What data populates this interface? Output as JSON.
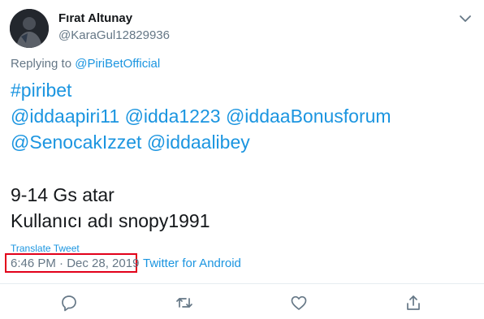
{
  "author": {
    "display_name": "Fırat Altunay",
    "handle": "@KaraGul12829936"
  },
  "reply": {
    "prefix": "Replying to ",
    "mention": "@PiriBetOfficial"
  },
  "tweet": {
    "hashtag": "#piribet",
    "mentions": [
      "@iddaapiri11",
      "@idda1223",
      "@iddaaBonusforum",
      "@SenocakIzzet",
      "@iddaalibey"
    ],
    "text_line_1": "9-14 Gs atar",
    "text_line_2": "Kullanıcı adı snopy1991"
  },
  "translate_label": "Translate Tweet",
  "timestamp": "6:46 PM · Dec 28, 2019",
  "source": "Twitter for Android",
  "actions": {
    "icons": [
      "reply-icon",
      "retweet-icon",
      "like-icon",
      "share-icon"
    ]
  },
  "colors": {
    "link": "#1b95e0",
    "secondary_text": "#657786",
    "highlight_box": "#e2001a",
    "divider": "#e6ecf0"
  }
}
